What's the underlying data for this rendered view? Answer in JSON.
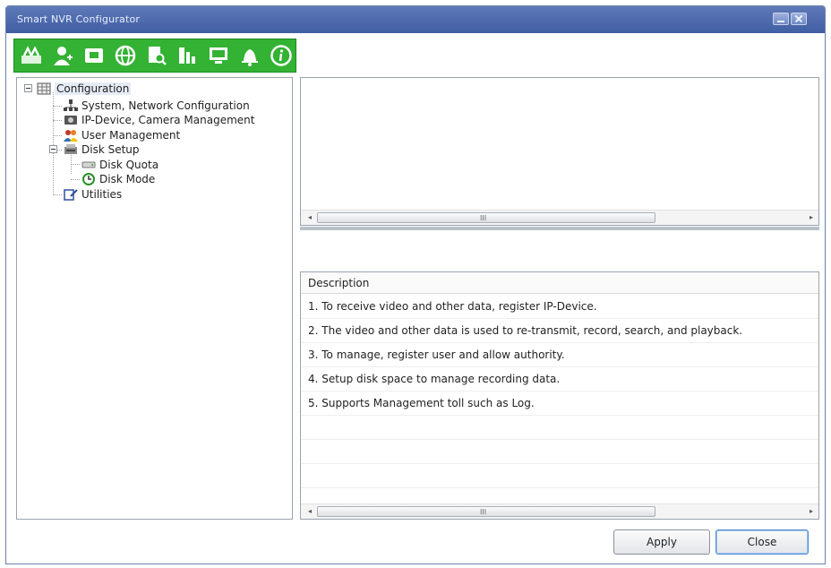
{
  "window": {
    "title": "Smart NVR Configurator"
  },
  "toolbar": {
    "icons": [
      "device-register-icon",
      "user-icon",
      "folder-icon",
      "network-globe-icon",
      "search-file-icon",
      "chart-icon",
      "monitor-icon",
      "bell-icon",
      "info-icon"
    ]
  },
  "tree": {
    "root": "Configuration",
    "items": [
      {
        "label": "System, Network Configuration"
      },
      {
        "label": "IP-Device, Camera Management"
      },
      {
        "label": "User Management"
      },
      {
        "label": "Disk Setup"
      },
      {
        "label": "Disk Quota"
      },
      {
        "label": "Disk Mode"
      },
      {
        "label": "Utilities"
      }
    ]
  },
  "description": {
    "header": "Description",
    "rows": [
      "1. To receive video and other data, register IP-Device.",
      "2. The video and other data is used to re-transmit, record, search, and playback.",
      "3. To manage, register user and allow authority.",
      "4. Setup disk space to manage recording data.",
      "5. Supports Management toll such as Log."
    ]
  },
  "scrollbar": {
    "grip": "III",
    "left_arrow": "◂",
    "right_arrow": "▸"
  },
  "buttons": {
    "apply": "Apply",
    "close": "Close"
  },
  "colors": {
    "toolbar_green": "#33b233",
    "titlebar_blue": "#4a66ab"
  }
}
